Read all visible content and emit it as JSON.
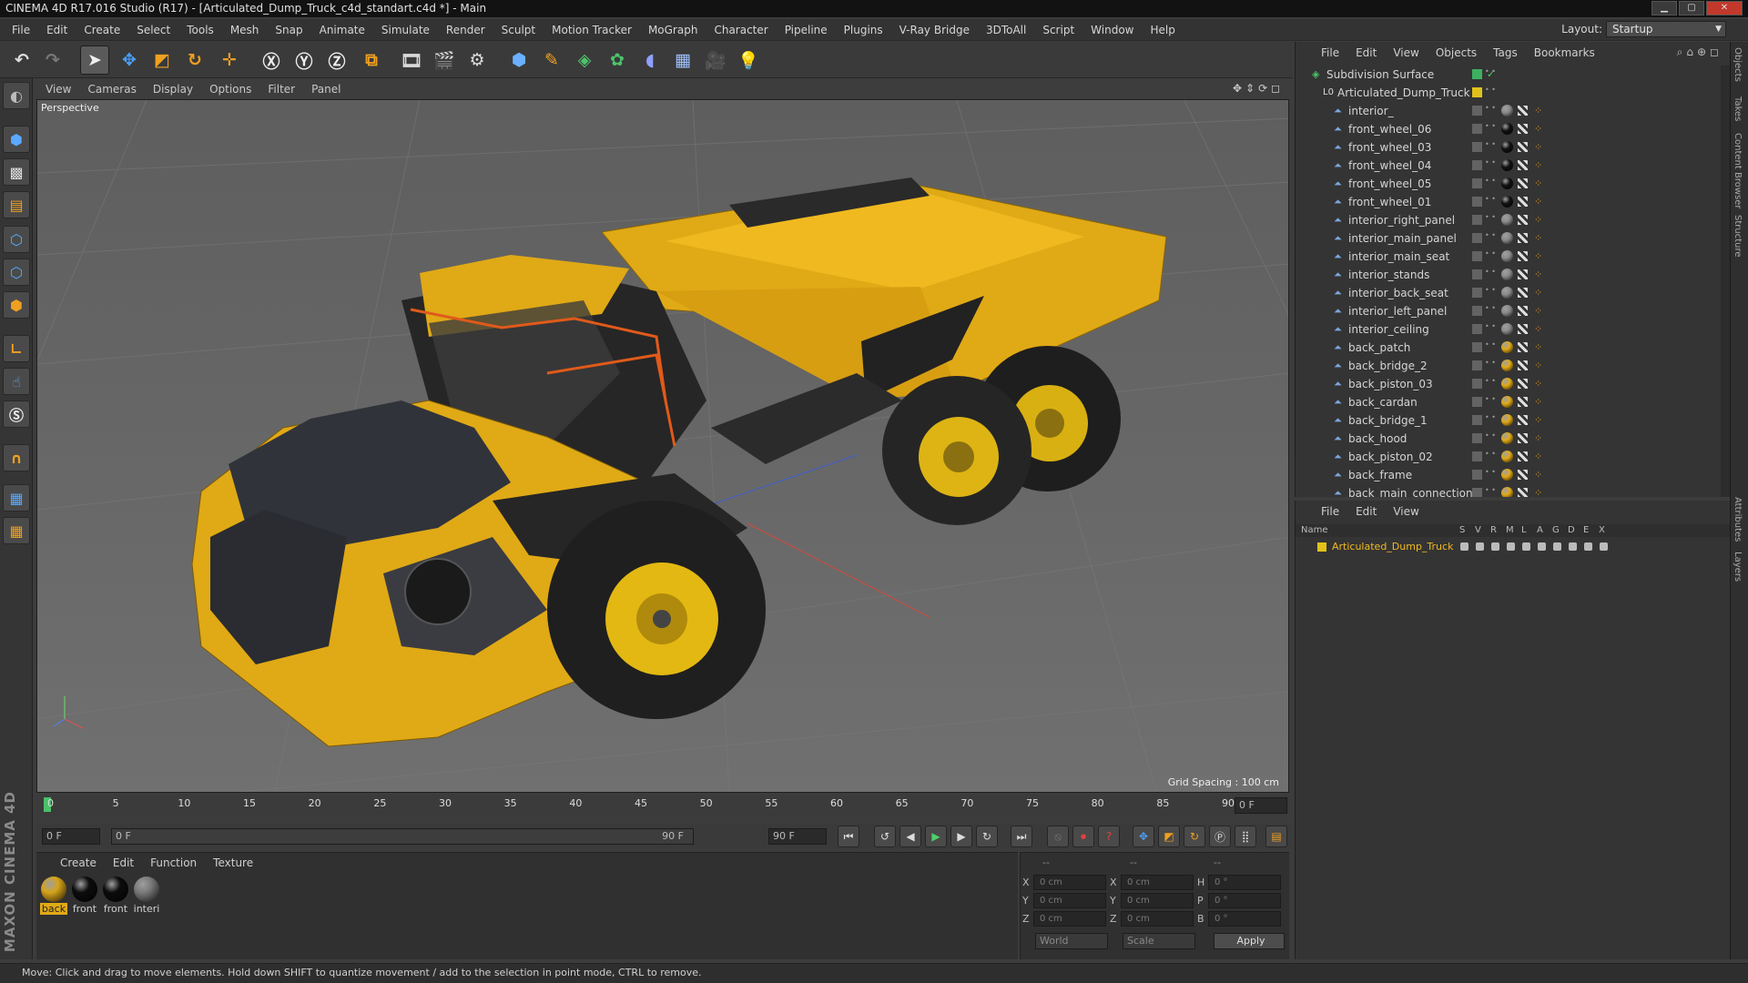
{
  "window": {
    "title": "CINEMA 4D R17.016 Studio (R17) - [Articulated_Dump_Truck_c4d_standart.c4d *] - Main"
  },
  "menu": [
    "File",
    "Edit",
    "Create",
    "Select",
    "Tools",
    "Mesh",
    "Snap",
    "Animate",
    "Simulate",
    "Render",
    "Sculpt",
    "Motion Tracker",
    "MoGraph",
    "Character",
    "Pipeline",
    "Plugins",
    "V-Ray Bridge",
    "3DToAll",
    "Script",
    "Window",
    "Help"
  ],
  "layout": {
    "label": "Layout:",
    "value": "Startup"
  },
  "viewport": {
    "menu": [
      "View",
      "Cameras",
      "Display",
      "Options",
      "Filter",
      "Panel"
    ],
    "camera_label": "Perspective",
    "grid_spacing": "Grid Spacing : 100 cm"
  },
  "timeline": {
    "ticks": [
      "0",
      "5",
      "10",
      "15",
      "20",
      "25",
      "30",
      "35",
      "40",
      "45",
      "50",
      "55",
      "60",
      "65",
      "70",
      "75",
      "80",
      "85",
      "90"
    ],
    "current_frame": "0 F",
    "start_field": "0 F",
    "range_start": "0 F",
    "range_end": "90 F",
    "end_field": "90 F"
  },
  "material_panel": {
    "menu": [
      "Create",
      "Edit",
      "Function",
      "Texture"
    ],
    "materials": [
      {
        "name": "back",
        "color": "#d6a31a"
      },
      {
        "name": "front",
        "color": "#0c0c0c"
      },
      {
        "name": "front",
        "color": "#0c0c0c"
      },
      {
        "name": "interi",
        "color": "#7a7a7a"
      }
    ]
  },
  "coordinates": {
    "header": [
      "--",
      "--",
      "--"
    ],
    "rows": [
      {
        "a": "X",
        "av": "0 cm",
        "b": "X",
        "bv": "0 cm",
        "c": "H",
        "cv": "0 °"
      },
      {
        "a": "Y",
        "av": "0 cm",
        "b": "Y",
        "bv": "0 cm",
        "c": "P",
        "cv": "0 °"
      },
      {
        "a": "Z",
        "av": "0 cm",
        "b": "Z",
        "bv": "0 cm",
        "c": "B",
        "cv": "0 °"
      }
    ],
    "world": "World",
    "scale": "Scale",
    "apply": "Apply"
  },
  "object_manager": {
    "menu": [
      "File",
      "Edit",
      "View",
      "Objects",
      "Tags",
      "Bookmarks"
    ],
    "objects": [
      {
        "name": "Subdivision Surface",
        "level": 0,
        "tag": "green"
      },
      {
        "name": "Articulated_Dump_Truck",
        "level": 1,
        "tag": "yellow"
      },
      {
        "name": "interior_",
        "level": 2,
        "tag": "grey"
      },
      {
        "name": "front_wheel_06",
        "level": 2,
        "tag": "black"
      },
      {
        "name": "front_wheel_03",
        "level": 2,
        "tag": "black"
      },
      {
        "name": "front_wheel_04",
        "level": 2,
        "tag": "black"
      },
      {
        "name": "front_wheel_05",
        "level": 2,
        "tag": "black"
      },
      {
        "name": "front_wheel_01",
        "level": 2,
        "tag": "black"
      },
      {
        "name": "interior_right_panel",
        "level": 2,
        "tag": "grey"
      },
      {
        "name": "interior_main_panel",
        "level": 2,
        "tag": "grey"
      },
      {
        "name": "interior_main_seat",
        "level": 2,
        "tag": "grey"
      },
      {
        "name": "interior_stands",
        "level": 2,
        "tag": "grey"
      },
      {
        "name": "interior_back_seat",
        "level": 2,
        "tag": "grey"
      },
      {
        "name": "interior_left_panel",
        "level": 2,
        "tag": "grey"
      },
      {
        "name": "interior_ceiling",
        "level": 2,
        "tag": "grey"
      },
      {
        "name": "back_patch",
        "level": 2,
        "tag": "orange"
      },
      {
        "name": "back_bridge_2",
        "level": 2,
        "tag": "orange"
      },
      {
        "name": "back_piston_03",
        "level": 2,
        "tag": "orange"
      },
      {
        "name": "back_cardan",
        "level": 2,
        "tag": "orange"
      },
      {
        "name": "back_bridge_1",
        "level": 2,
        "tag": "orange"
      },
      {
        "name": "back_hood",
        "level": 2,
        "tag": "orange"
      },
      {
        "name": "back_piston_02",
        "level": 2,
        "tag": "orange"
      },
      {
        "name": "back_frame",
        "level": 2,
        "tag": "orange"
      },
      {
        "name": "back_main_connection",
        "level": 2,
        "tag": "orange"
      }
    ]
  },
  "layer_manager": {
    "menu": [
      "File",
      "Edit",
      "View"
    ],
    "columns": [
      "Name",
      "S",
      "V",
      "R",
      "M",
      "L",
      "A",
      "G",
      "D",
      "E",
      "X"
    ],
    "layers": [
      {
        "name": "Articulated_Dump_Truck",
        "color": "#e2c21a"
      }
    ]
  },
  "side_tabs": [
    "Objects",
    "Takes",
    "Content Browser",
    "Structure",
    "Attributes",
    "Layers"
  ],
  "status": "Move: Click and drag to move elements. Hold down SHIFT to quantize movement / add to the selection in point mode, CTRL to remove.",
  "brand": "MAXON CINEMA 4D"
}
